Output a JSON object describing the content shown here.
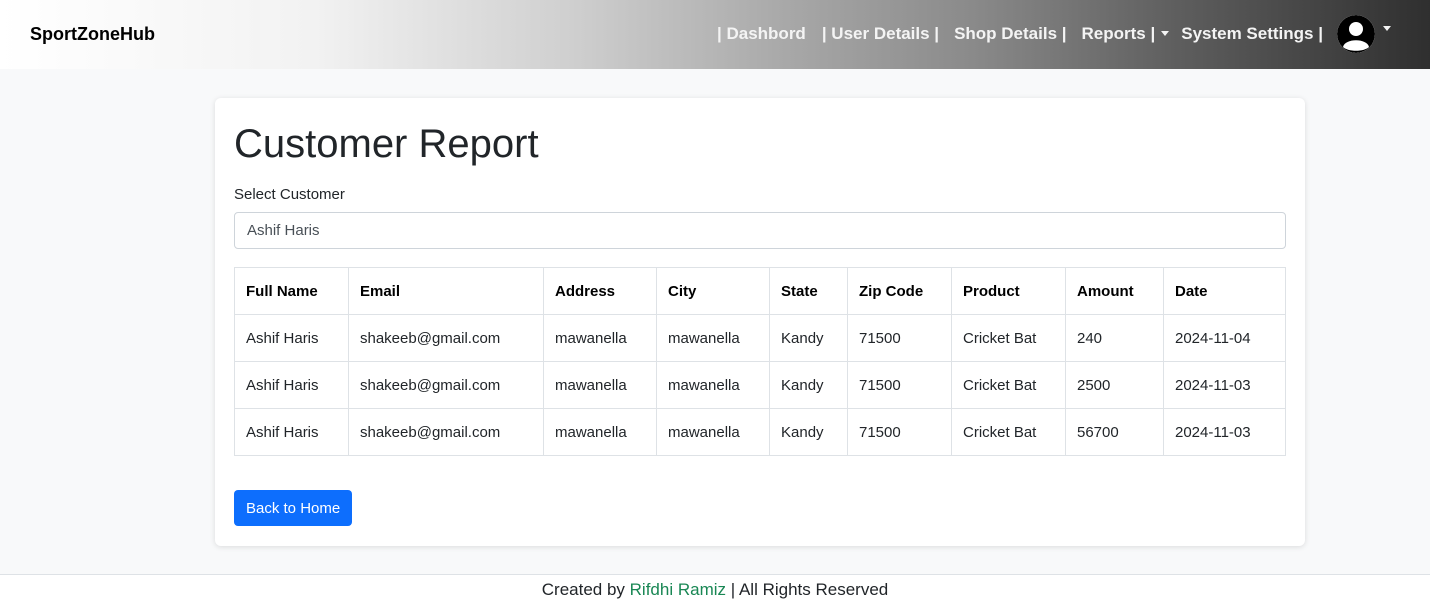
{
  "navbar": {
    "brand": "SportZoneHub",
    "links": [
      "| Dashbord",
      "| User Details |",
      "Shop Details |",
      "Reports |",
      "System Settings |"
    ]
  },
  "page": {
    "title": "Customer Report",
    "select_label": "Select Customer",
    "selected_customer": "Ashif Haris"
  },
  "table": {
    "headers": [
      "Full Name",
      "Email",
      "Address",
      "City",
      "State",
      "Zip Code",
      "Product",
      "Amount",
      "Date"
    ],
    "rows": [
      [
        "Ashif Haris",
        "shakeeb@gmail.com",
        "mawanella",
        "mawanella",
        "Kandy",
        "71500",
        "Cricket Bat",
        "240",
        "2024-11-04"
      ],
      [
        "Ashif Haris",
        "shakeeb@gmail.com",
        "mawanella",
        "mawanella",
        "Kandy",
        "71500",
        "Cricket Bat",
        "2500",
        "2024-11-03"
      ],
      [
        "Ashif Haris",
        "shakeeb@gmail.com",
        "mawanella",
        "mawanella",
        "Kandy",
        "71500",
        "Cricket Bat",
        "56700",
        "2024-11-03"
      ]
    ]
  },
  "buttons": {
    "back_home": "Back to Home"
  },
  "footer": {
    "prefix": "Created by",
    "author": "Rifdhi Ramiz",
    "suffix": "| All Rights Reserved"
  },
  "icons": {
    "avatar": "user-avatar-icon",
    "dropdown": "caret-down-icon"
  },
  "colors": {
    "primary_button": "#0d6efd",
    "author_link": "#198754"
  }
}
